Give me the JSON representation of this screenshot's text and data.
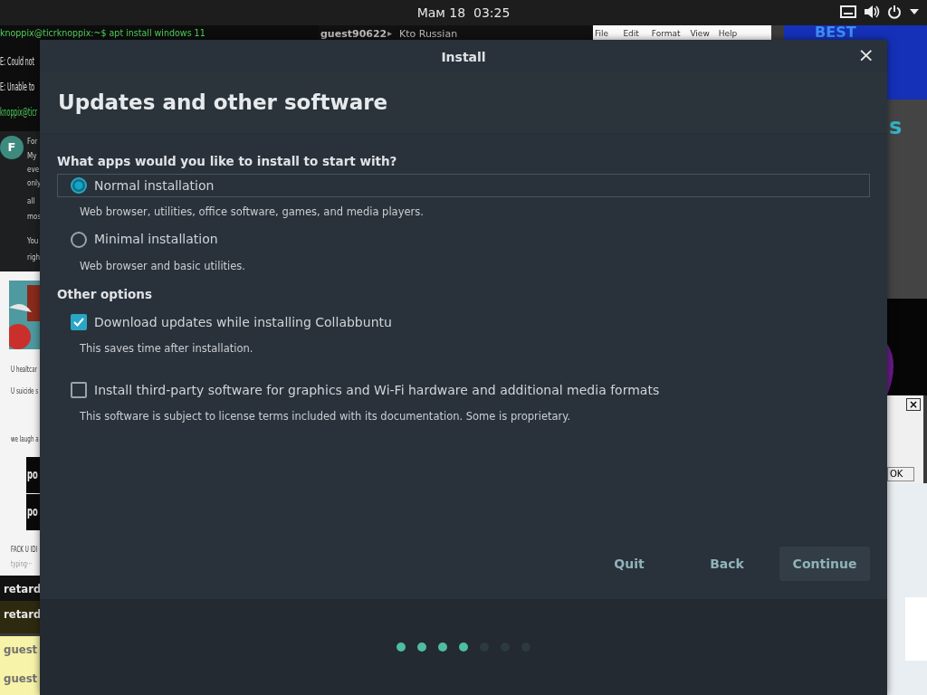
{
  "top_bar": {
    "clock": "Мам 18  03:25"
  },
  "desktop": {
    "terminal_lines": [
      "knoppix@ticrknoppix:~$ apt install windows 11",
      "E: Could not",
      "E: Unable to",
      "knoppix@ticr"
    ],
    "chat_header": {
      "user": "guest90622",
      "arrow": "▸",
      "topic": "Kto Russian"
    },
    "notepad_menu": [
      "File",
      "Edit",
      "Format",
      "View",
      "Help"
    ],
    "banner": "BEST",
    "forum": {
      "avatar": "F",
      "lines": [
        "For",
        "My",
        "eve",
        "only",
        "all",
        "mos",
        "You",
        "righ"
      ]
    },
    "feed_lines": [
      "U healtcar",
      "U suicide s",
      "we laugh a",
      "FACK U IDI",
      "typing···"
    ],
    "feed_blocks": [
      "po",
      "po"
    ],
    "chat_users": [
      {
        "name": "retard",
        "color": "#121212"
      },
      {
        "name": "retard",
        "color": "#2e2a10"
      },
      {
        "name": "guest",
        "color": "#f7f3a8"
      },
      {
        "name": "guest",
        "color": "#f7f3a8"
      }
    ],
    "side_text": "s",
    "small_dialog": {
      "close": "×",
      "button": "OK"
    }
  },
  "dialog": {
    "title": "Install",
    "close": "×",
    "heading": "Updates and other software",
    "question": "What apps would you like to install to start with?",
    "install_types": [
      {
        "label": "Normal installation",
        "description": "Web browser, utilities, office software, games, and media players.",
        "selected": true
      },
      {
        "label": "Minimal installation",
        "description": "Web browser and basic utilities.",
        "selected": false
      }
    ],
    "other_options_title": "Other options",
    "options": [
      {
        "label": "Download updates while installing Collabbuntu",
        "description": "This saves time after installation.",
        "checked": true
      },
      {
        "label": "Install third-party software for graphics and Wi-Fi hardware and additional media formats",
        "description": "This software is subject to license terms included with its documentation. Some is proprietary.",
        "checked": false
      }
    ],
    "buttons": [
      {
        "label": "Quit",
        "hovered": false
      },
      {
        "label": "Back",
        "hovered": false
      },
      {
        "label": "Continue",
        "hovered": true
      }
    ],
    "steps": [
      {
        "done": true
      },
      {
        "done": true
      },
      {
        "done": true
      },
      {
        "done": true
      },
      {
        "done": false
      },
      {
        "done": false
      },
      {
        "done": false
      }
    ]
  }
}
